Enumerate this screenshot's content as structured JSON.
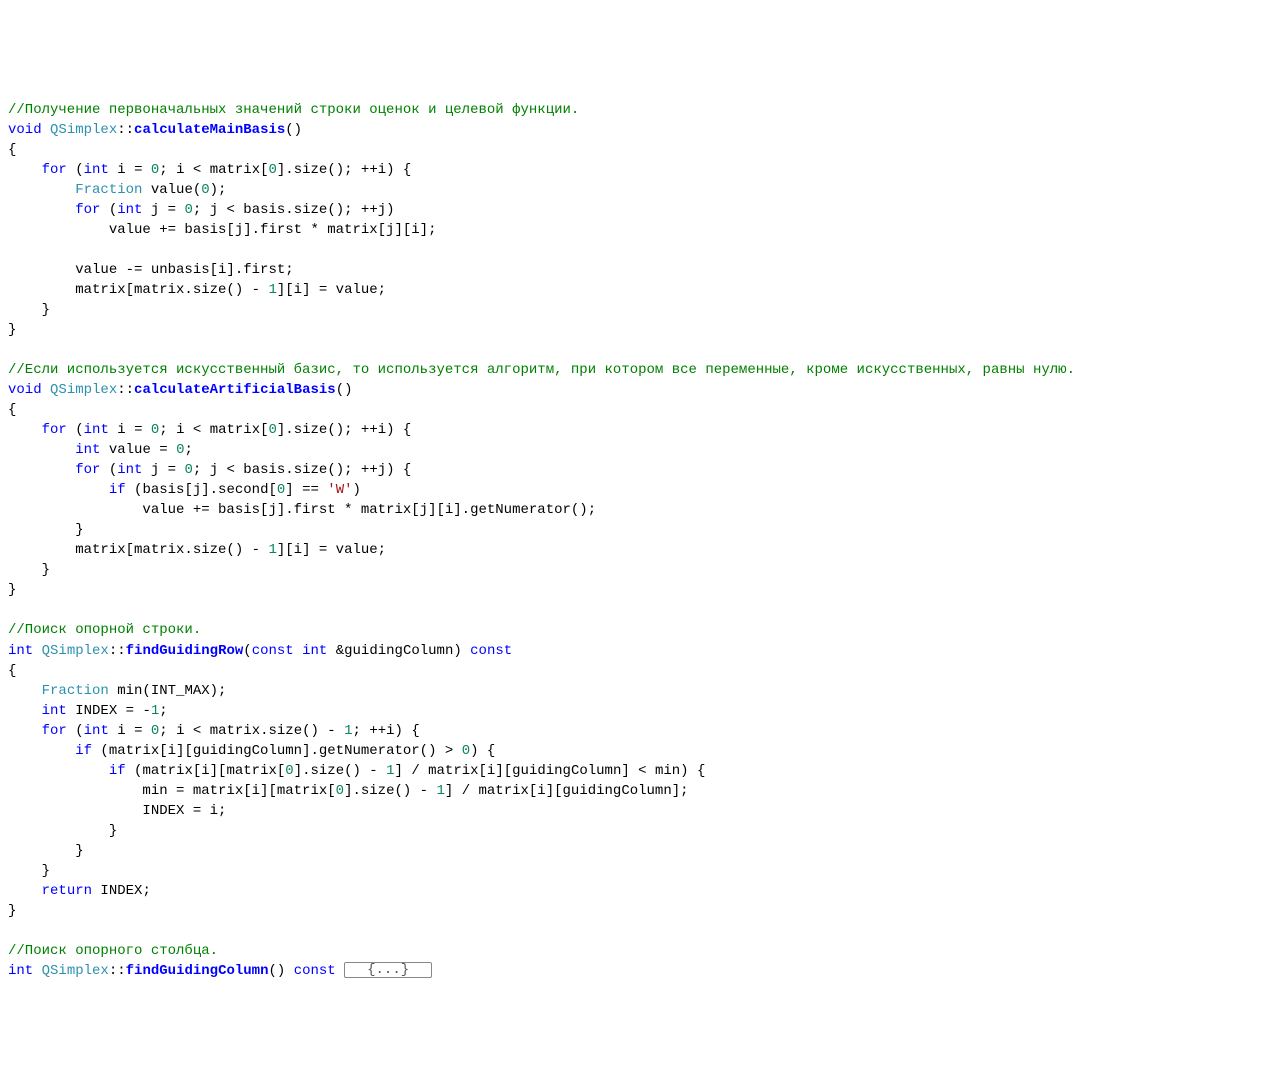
{
  "code": {
    "comment1": "//Получение первоначальных значений строки оценок и целевой функции.",
    "kw_void1": "void",
    "ty_qsimplex1": "QSimplex",
    "fn_calcmain": "calculateMainBasis",
    "brace_ob1": "{",
    "kw_for1": "for",
    "kw_int1": "int",
    "id_i": "i",
    "eq": " = ",
    "nm_0": "0",
    "semicolon_sp": "; ",
    "lt": " < ",
    "id_matrix": "matrix",
    "lbr": "[",
    "rbr": "]",
    "dot": ".",
    "id_size": "size",
    "parens": "()",
    "pp_i": "++i",
    "pp_j": "++j",
    "sp_ob": " {",
    "ty_fraction": "Fraction",
    "id_value": "value",
    "call_value0": "value",
    "lp": "(",
    "rp": ")",
    "semi": ";",
    "kw_for2": "for",
    "kw_int_j": "int",
    "id_j": "j",
    "id_basis": "basis",
    "plus_eq": " += ",
    "id_first": "first",
    "star": " * ",
    "minus_eq": " -= ",
    "id_unbasis": "unbasis",
    "minus1": " - ",
    "nm_1": "1",
    "assign_value": " = value;",
    "cb": "}",
    "comment2": "//Если используется искусственный базис, то используется алгоритм, при котором все переменные, кроме искусственных, равны нулю.",
    "kw_void2": "void",
    "ty_qsimplex2": "QSimplex",
    "fn_calcart": "calculateArtificialBasis",
    "kw_if": "if",
    "id_second": "second",
    "eqeq": " == ",
    "ch_W": "'W'",
    "id_getnum": "getNumerator",
    "comment3": "//Поиск опорной строки.",
    "kw_int_ret": "int",
    "ty_qsimplex3": "QSimplex",
    "fn_findrow": "findGuidingRow",
    "kw_const": "const",
    "amp": " &",
    "id_guidingcol": "guidingColumn",
    "ty_fraction2": "Fraction",
    "id_min": "min",
    "id_intmax": "INT_MAX",
    "id_INDEX": "INDEX",
    "nm_neg1": "-1",
    "gt": " > ",
    "div": " / ",
    "kw_return": "return",
    "comment4": "//Поиск опорного столбца.",
    "ty_qsimplex4": "QSimplex",
    "fn_findcol": "findGuidingColumn",
    "fold_label": "{...}",
    "dcolon": "::"
  }
}
